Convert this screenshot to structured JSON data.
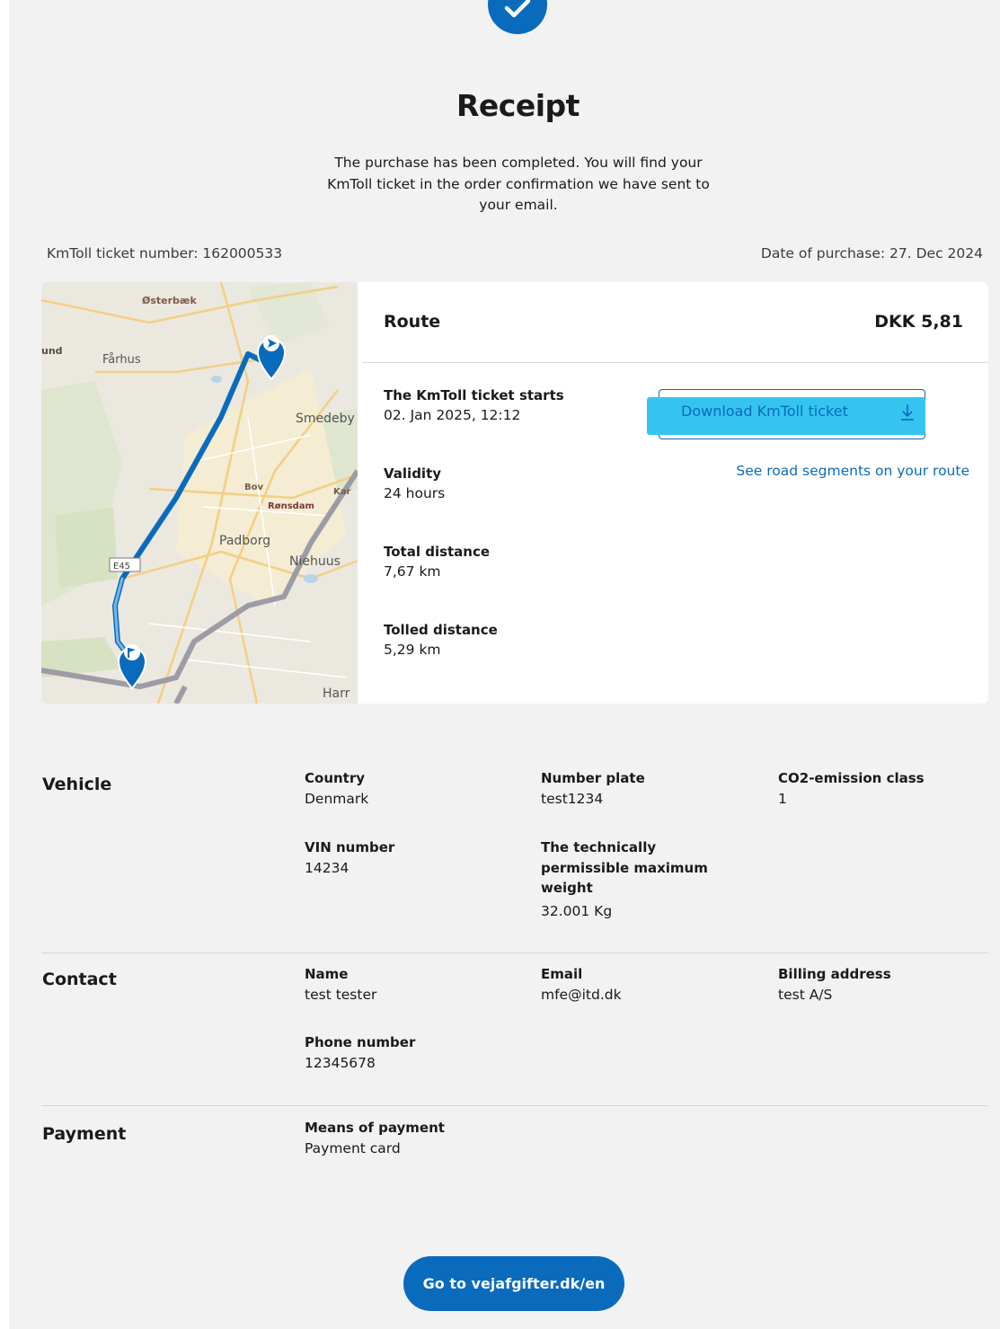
{
  "header": {
    "title": "Receipt",
    "subtitle_lines": [
      "The purchase has been completed. You will find your",
      "KmToll ticket in the order confirmation we have sent to",
      "your email."
    ],
    "ticket_number": "KmToll ticket number: 162000533",
    "purchase_date": "Date of purchase: 27. Dec 2024"
  },
  "map": {
    "places": {
      "osterbaek": "Østerbæk",
      "und": "und",
      "farhus": "Fårhus",
      "smedeby": "Smedeby",
      "bov": "Bov",
      "kar": "Kar",
      "ronsdam": "Rønsdam",
      "padborg": "Padborg",
      "e45": "E45",
      "niehuus": "Niehuus",
      "harr": "Harr"
    },
    "route_color": "#0a6bbd"
  },
  "route": {
    "title": "Route",
    "price": "DKK 5,81",
    "starts_label": "The KmToll ticket starts",
    "starts_value": "02. Jan 2025, 12:12",
    "validity_label": "Validity",
    "validity_value": "24 hours",
    "total_distance_label": "Total distance",
    "total_distance_value": "7,67 km",
    "tolled_distance_label": "Tolled distance",
    "tolled_distance_value": "5,29 km",
    "download_label": "Download KmToll ticket",
    "segments_link": "See road segments on your route"
  },
  "vehicle": {
    "title": "Vehicle",
    "country_label": "Country",
    "country_value": "Denmark",
    "plate_label": "Number plate",
    "plate_value": "test1234",
    "co2_label": "CO2-emission class",
    "co2_value": "1",
    "vin_label": "VIN number",
    "vin_value": "14234",
    "weight_label_lines": [
      "The technically",
      "permissible maximum",
      "weight"
    ],
    "weight_value": "32.001 Kg"
  },
  "contact": {
    "title": "Contact",
    "name_label": "Name",
    "name_value": "test tester",
    "email_label": "Email",
    "email_value": "mfe@itd.dk",
    "billing_label": "Billing address",
    "billing_value": "test A/S",
    "phone_label": "Phone number",
    "phone_value": "12345678"
  },
  "payment": {
    "title": "Payment",
    "means_label": "Means of payment",
    "means_value": "Payment card"
  },
  "cta": {
    "label": "Go to vejafgifter.dk/en"
  },
  "colors": {
    "accent": "#0a6bbd",
    "highlight": "#35c4ef",
    "background": "#f2f2f2"
  }
}
